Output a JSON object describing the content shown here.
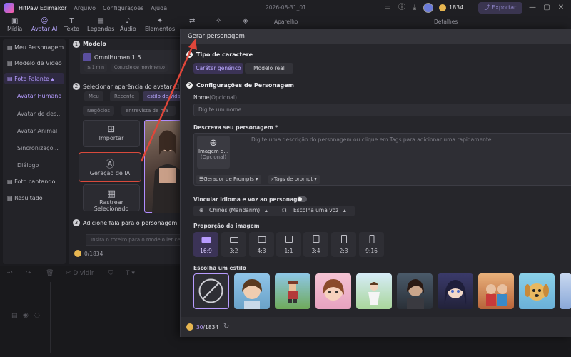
{
  "app": {
    "name": "HitPaw Edimakor",
    "menus": [
      "Arquivo",
      "Configurações",
      "Ajuda"
    ],
    "date": "2026-08-31_01",
    "coins": "1834",
    "export_label": "Exportar"
  },
  "toolbar": {
    "tabs": [
      "Mídia",
      "Avatar AI",
      "Texto",
      "Legendas",
      "Áudio",
      "Elementos"
    ],
    "active": "Avatar AI"
  },
  "sidebar": {
    "items": [
      {
        "label": "Meu Personagem"
      },
      {
        "label": "Modelo de Vídeo"
      },
      {
        "label": "Foto Falante"
      },
      {
        "label": "Avatar Humano"
      },
      {
        "label": "Avatar de des..."
      },
      {
        "label": "Avatar Animal"
      },
      {
        "label": "Sincronizaçõ..."
      },
      {
        "label": "Diálogo"
      },
      {
        "label": "Foto cantando"
      },
      {
        "label": "Resultado"
      }
    ]
  },
  "middle": {
    "sec1_num": "1",
    "sec1_title": "Modelo",
    "model_name": "OmniHuman 1.5",
    "model_chip1": "≤ 1 min",
    "model_chip2": "Controle de movimento",
    "sec2_num": "2",
    "sec2_title": "Selecionar aparência do avatar",
    "sec2_suffix": "Cli",
    "filters": [
      "Meu",
      "Recente",
      "estilo de vida",
      "Negócios",
      "entrevista de ma"
    ],
    "import_label": "Importar",
    "genia_label": "Geração de IA",
    "rastrear_label": "Rastrear Selecionado",
    "sec3_num": "3",
    "sec3_title": "Adicione fala para o personagem",
    "script_placeholder": "Insira o roteiro para o modelo ler ce",
    "count": "0/1834"
  },
  "right_bg": {
    "tab1": "Aparelho",
    "tab2": "Detalhes"
  },
  "timeline": {
    "split_label": "Dividir"
  },
  "modal": {
    "title": "Gerar personagem",
    "s1_num": "1",
    "s1_title": "Tipo de caractere",
    "type_options": [
      "Caráter genérico",
      "Modelo real"
    ],
    "s2_num": "2",
    "s2_title": "Configurações de Personagem",
    "name_label": "Nome",
    "name_optional": "(Opcional)",
    "name_placeholder": "Digite um nome",
    "describe_label": "Descreva seu personagem *",
    "describe_placeholder": "Digite uma descrição do personagem ou clique em Tags para adicionar uma rapidamente.",
    "image_label": "Imagem d...",
    "image_optional": "(Opcional)",
    "prompt_gen": "Gerador de Prompts",
    "prompt_tags": "Tags de prompt",
    "voice_label": "Vincular idioma e voz ao personagem",
    "language": "Chinês (Mandarim)",
    "voice_choice": "Escolha uma voz",
    "ratio_label": "Proporção da imagem",
    "ratios": [
      "16:9",
      "3:2",
      "4:3",
      "1:1",
      "3:4",
      "2:3",
      "9:16"
    ],
    "style_label": "Escolha um estilo",
    "footer_count": "30/1834"
  }
}
